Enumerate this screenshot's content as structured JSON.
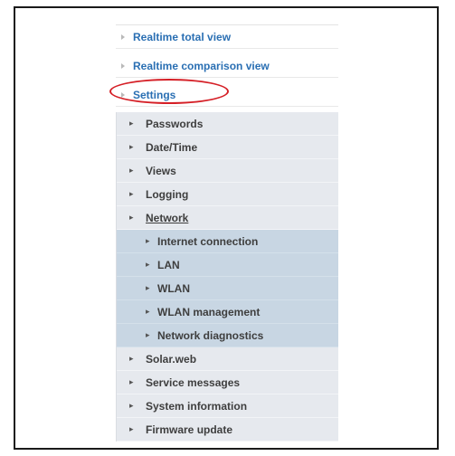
{
  "menu": {
    "top": [
      {
        "label": "Realtime total view"
      },
      {
        "label": "Realtime comparison view"
      },
      {
        "label": "Settings"
      }
    ],
    "settings_items": [
      {
        "label": "Passwords"
      },
      {
        "label": "Date/Time"
      },
      {
        "label": "Views"
      },
      {
        "label": "Logging"
      },
      {
        "label": "Network"
      }
    ],
    "network_items": [
      {
        "label": "Internet connection"
      },
      {
        "label": "LAN"
      },
      {
        "label": "WLAN"
      },
      {
        "label": "WLAN management"
      },
      {
        "label": "Network diagnostics"
      }
    ],
    "other_items": [
      {
        "label": "Solar.web"
      },
      {
        "label": "Service messages"
      },
      {
        "label": "System information"
      },
      {
        "label": "Firmware update"
      }
    ]
  },
  "colors": {
    "link": "#2a6fb3",
    "highlight_ring": "#d51f26",
    "submenu_bg": "#e6e9ee",
    "network_bg": "#c8d6e3"
  },
  "icons": {
    "top_marker": "triangle-right-icon",
    "sub_marker": "chevron-right-icon"
  }
}
